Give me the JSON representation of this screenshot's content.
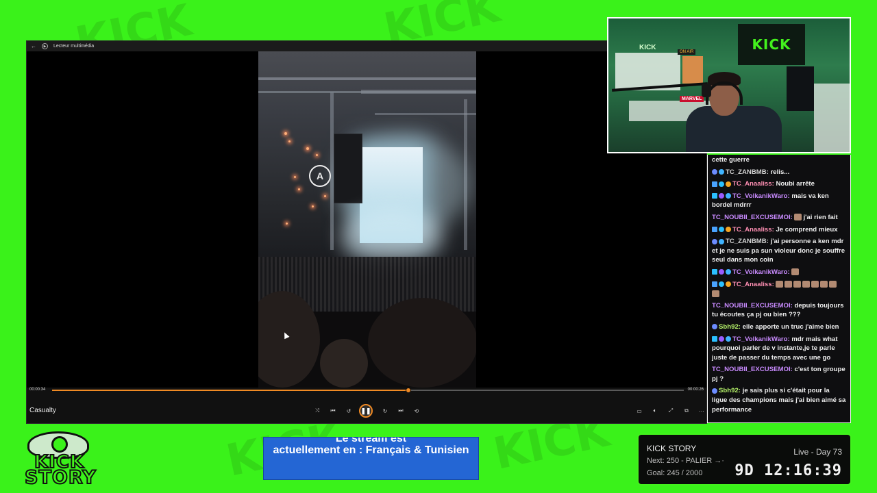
{
  "player": {
    "window_title": "Lecteur multimédia",
    "time_elapsed": "00:00:34",
    "time_total": "00:00:26",
    "progress": 0.564,
    "track_title": "Casualty",
    "icons": {
      "back": "back-arrow-icon",
      "app": "media-player-icon",
      "shuffle": "shuffle-icon",
      "previous": "previous-icon",
      "rewind": "rewind-10-icon",
      "play_pause": "pause-icon",
      "forward": "forward-30-icon",
      "next": "next-icon",
      "repeat": "repeat-off-icon",
      "miniplayer": "miniplayer-icon",
      "volume": "volume-icon",
      "fullscreen": "fullscreen-icon",
      "cast": "cast-icon",
      "more": "more-options-icon"
    },
    "accent_color": "#f08a24"
  },
  "webcam": {
    "kick_flag": "KICK",
    "kick_small": "KICK",
    "on_air": "ON AIR",
    "marvel": "MARVEL"
  },
  "chat": {
    "messages": [
      {
        "user": "",
        "user_color": "#efefef",
        "text": "cette guerre",
        "badges": []
      },
      {
        "user": "TC_ZANBMB:",
        "user_color": "#d4d4d4",
        "text": "relis...",
        "badges": [
          "#6c8cff",
          "#40b4ff"
        ]
      },
      {
        "user": "TC_Anaaliss:",
        "user_color": "#ff8fb3",
        "text": "Noubi arrête",
        "badges": [
          "#4aa3ff",
          "#2bc0ff",
          "#f5a623"
        ]
      },
      {
        "user": "TC_VolkanikWaro:",
        "user_color": "#c98bff",
        "text": "mais va ken bordel mdrrr",
        "badges": [
          "#2bc0ff",
          "#9a5cff",
          "#40b4ff"
        ]
      },
      {
        "user": "TC_NOUBII_EXCUSEMOI:",
        "user_color": "#c98bff",
        "text": "j'ai rien fait",
        "emote": true,
        "badges": []
      },
      {
        "user": "TC_Anaaliss:",
        "user_color": "#ff8fb3",
        "text": "Je comprend mieux",
        "badges": [
          "#4aa3ff",
          "#2bc0ff",
          "#f5a623"
        ]
      },
      {
        "user": "TC_ZANBMB:",
        "user_color": "#d4d4d4",
        "text": "j'ai personne a ken mdr et je ne suis pa sun violeur donc je souffre seul dans mon coin",
        "badges": [
          "#6c8cff",
          "#40b4ff"
        ]
      },
      {
        "user": "TC_VolkanikWaro:",
        "user_color": "#c98bff",
        "text": "",
        "emote": true,
        "badges": [
          "#2bc0ff",
          "#9a5cff",
          "#40b4ff"
        ]
      },
      {
        "user": "TC_Anaaliss:",
        "user_color": "#ff8fb3",
        "text": "",
        "emotes": 8,
        "badges": [
          "#4aa3ff",
          "#2bc0ff",
          "#f5a623"
        ]
      },
      {
        "user": "TC_NOUBII_EXCUSEMOI:",
        "user_color": "#c98bff",
        "text": "depuis toujours tu écoutes ça pj ou bien ???",
        "badges": []
      },
      {
        "user": "Sbh92:",
        "user_color": "#b6f36a",
        "text": "elle apporte un truc j'aime bien",
        "badges": [
          "#6c8cff"
        ]
      },
      {
        "user": "TC_VolkanikWaro:",
        "user_color": "#c98bff",
        "text": "mdr mais what pourquoi parler de v instante,je te parle juste de passer du temps avec une go",
        "badges": [
          "#2bc0ff",
          "#9a5cff",
          "#40b4ff"
        ]
      },
      {
        "user": "TC_NOUBII_EXCUSEMOI:",
        "user_color": "#c98bff",
        "text": "c'est ton groupe pj ?",
        "badges": []
      },
      {
        "user": "Sbh92:",
        "user_color": "#b6f36a",
        "text": "je sais plus si c'était pour la ligue des champions mais j'ai bien aimé sa performance",
        "badges": [
          "#6c8cff"
        ]
      }
    ]
  },
  "logo": {
    "line1": "KICK",
    "line2": "STORY"
  },
  "language_banner": {
    "top_partial": "Le stream est",
    "main": "actuellement en : Français & Tunisien"
  },
  "info_panel": {
    "title": "KICK STORY",
    "live_label": "Live - Day 73",
    "next": "Next: 250 - PALIER →·",
    "goal": "Goal: 245 / 2000",
    "timer": "9D 12:16:39",
    "accent": "#43f21d"
  }
}
